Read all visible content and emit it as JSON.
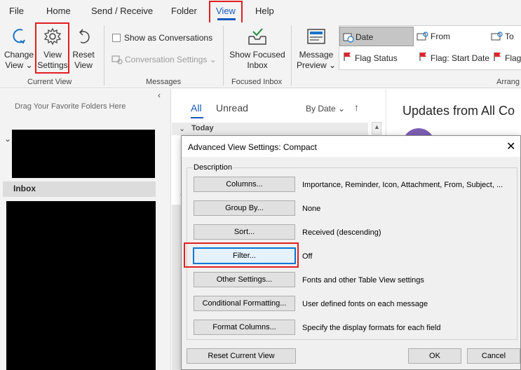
{
  "tabs": [
    "File",
    "Home",
    "Send / Receive",
    "Folder",
    "View",
    "Help"
  ],
  "active_tab": "View",
  "ribbon": {
    "current_view": {
      "change_view": [
        "Change",
        "View ⌄"
      ],
      "view_settings": [
        "View",
        "Settings"
      ],
      "reset_view": [
        "Reset",
        "View"
      ],
      "group_label": "Current View"
    },
    "messages": {
      "show_as_conversations": "Show as Conversations",
      "conversation_settings": "Conversation Settings ⌄",
      "group_label": "Messages"
    },
    "focused_inbox": {
      "button": [
        "Show Focused",
        "Inbox"
      ],
      "group_label": "Focused Inbox"
    },
    "arrangement": {
      "message_preview": [
        "Message",
        "Preview ⌄"
      ],
      "items": [
        "Date",
        "From",
        "To",
        "Flag Status",
        "Flag: Start Date",
        "Flag"
      ],
      "selected": "Date",
      "group_label": "Arrang"
    }
  },
  "folder_pane": {
    "hint": "Drag Your Favorite Folders Here",
    "inbox_label": "Inbox"
  },
  "message_list": {
    "tab_all": "All",
    "tab_unread": "Unread",
    "sort": "By Date ⌄",
    "group_today": "Today"
  },
  "reading_pane": {
    "title": "Updates from All Co"
  },
  "dialog": {
    "title": "Advanced View Settings: Compact",
    "section": "Description",
    "rows": [
      {
        "button": "Columns...",
        "value": "Importance, Reminder, Icon, Attachment, From, Subject, ..."
      },
      {
        "button": "Group By...",
        "value": "None"
      },
      {
        "button": "Sort...",
        "value": "Received (descending)"
      },
      {
        "button": "Filter...",
        "value": "Off"
      },
      {
        "button": "Other Settings...",
        "value": "Fonts and other Table View settings"
      },
      {
        "button": "Conditional Formatting...",
        "value": "User defined fonts on each message"
      },
      {
        "button": "Format Columns...",
        "value": "Specify the display formats for each field"
      }
    ],
    "reset": "Reset Current View",
    "ok": "OK",
    "cancel": "Cancel"
  },
  "colors": {
    "accent": "#185abd",
    "highlight_red": "#e02020",
    "flag_red": "#d9262c"
  }
}
